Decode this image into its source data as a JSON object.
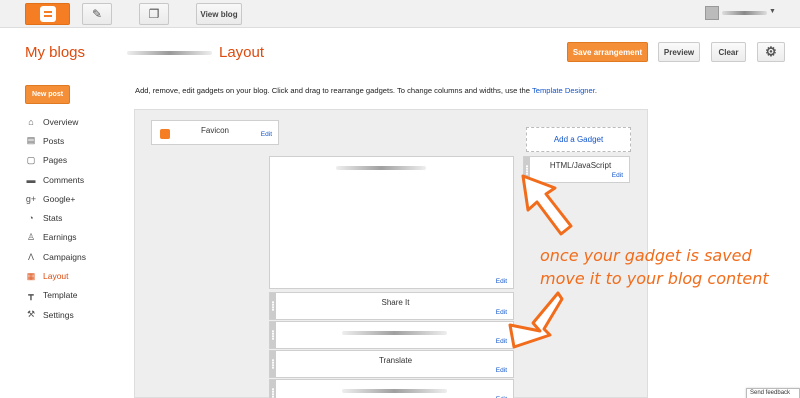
{
  "topbar": {
    "view_blog_label": "View blog",
    "icons": [
      "blogger-logo-icon",
      "pencil-icon",
      "copy-icon",
      "avatar-icon",
      "chevron-down-icon"
    ]
  },
  "header": {
    "my_blogs": "My blogs",
    "page_title": "Layout",
    "save_label": "Save arrangement",
    "preview_label": "Preview",
    "clear_label": "Clear"
  },
  "sidebar": {
    "new_post_label": "New post",
    "items": [
      {
        "label": "Overview",
        "icon": "home-icon",
        "glyph": "⌂"
      },
      {
        "label": "Posts",
        "icon": "posts-icon",
        "glyph": "▤"
      },
      {
        "label": "Pages",
        "icon": "pages-icon",
        "glyph": "▢"
      },
      {
        "label": "Comments",
        "icon": "comment-icon",
        "glyph": "▬"
      },
      {
        "label": "Google+",
        "icon": "google-plus-icon",
        "glyph": "g+"
      },
      {
        "label": "Stats",
        "icon": "stats-icon",
        "glyph": "◔"
      },
      {
        "label": "Earnings",
        "icon": "earnings-icon",
        "glyph": "♙"
      },
      {
        "label": "Campaigns",
        "icon": "campaigns-icon",
        "glyph": "Λ"
      },
      {
        "label": "Layout",
        "icon": "layout-icon",
        "glyph": "▦",
        "active": true
      },
      {
        "label": "Template",
        "icon": "template-icon",
        "glyph": "┳"
      },
      {
        "label": "Settings",
        "icon": "settings-icon",
        "glyph": "⚒"
      }
    ]
  },
  "instructions": {
    "text": "Add, remove, edit gadgets on your blog. Click and drag to rearrange gadgets. To change columns and widths, use the ",
    "link": "Template Designer",
    "suffix": "."
  },
  "canvas": {
    "favicon_title": "Favicon",
    "edit_label": "Edit",
    "add_gadget_label": "Add a Gadget",
    "html_gadget_title": "HTML/JavaScript",
    "share_title": "Share It",
    "translate_title": "Translate"
  },
  "annotation": {
    "line1": "once your gadget is saved",
    "line2": "move it to your blog content"
  },
  "feedback_label": "Send feedback",
  "colors": {
    "accent": "#f57d23",
    "link": "#1155cc",
    "annotation": "#f16c1b"
  }
}
